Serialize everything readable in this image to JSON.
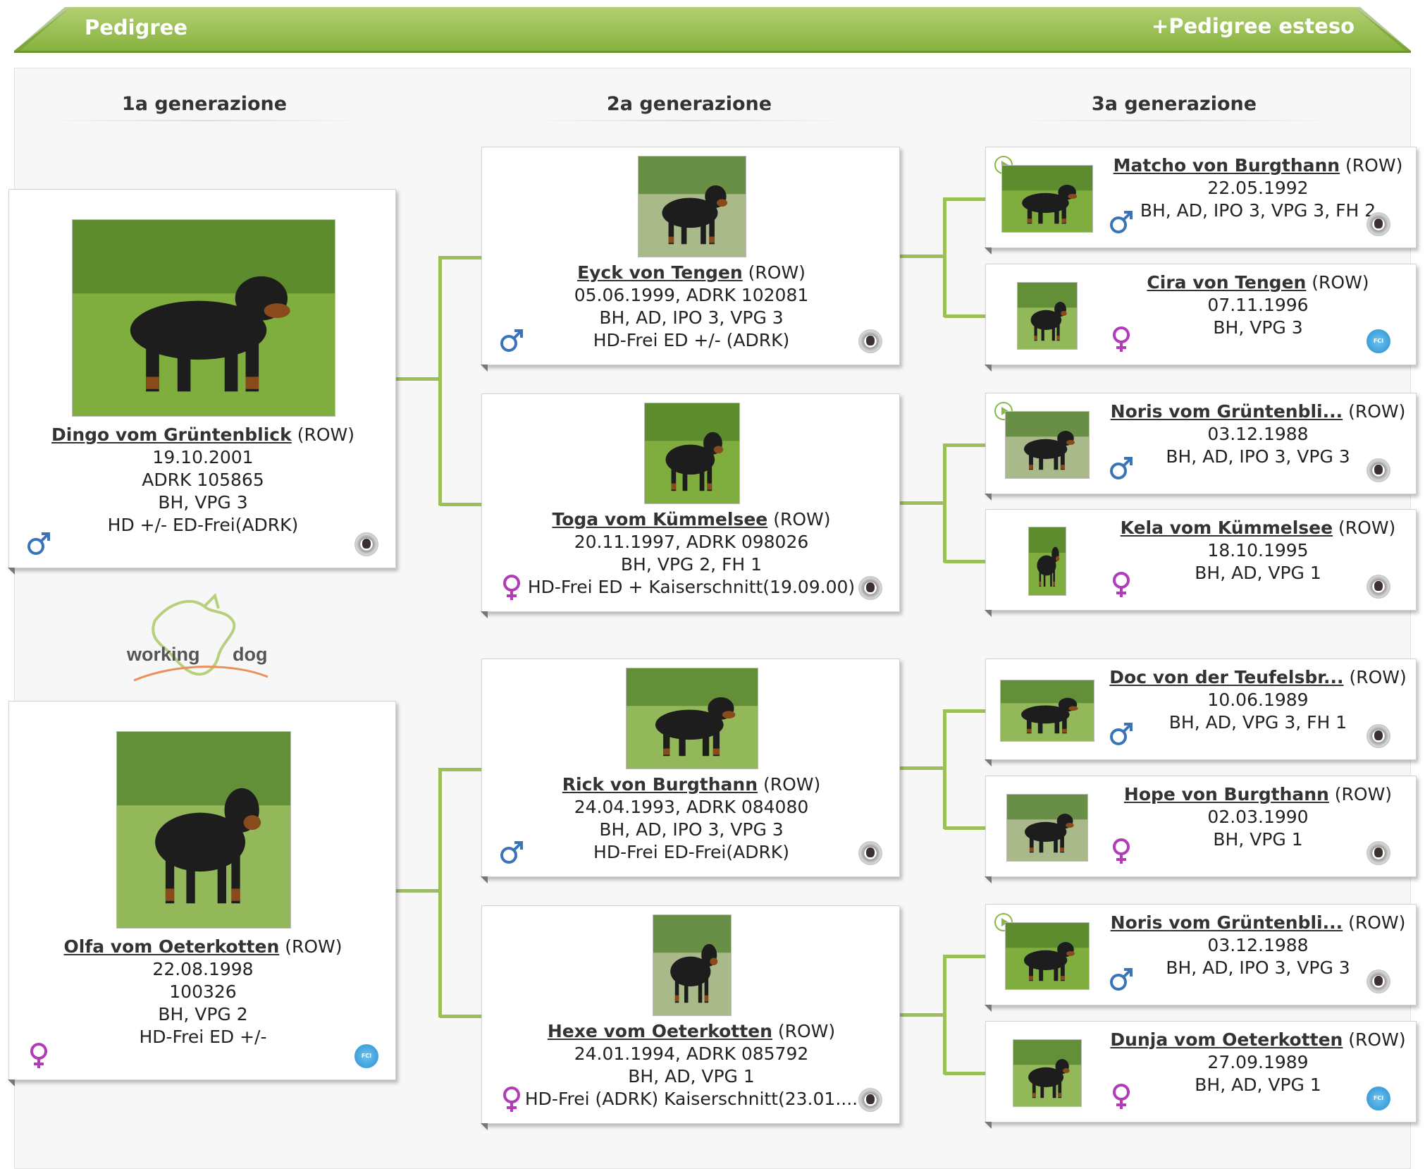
{
  "header": {
    "title": "Pedigree",
    "extended_link": "+Pedigree esteso"
  },
  "generations": [
    "1a generazione",
    "2a generazione",
    "3a generazione"
  ],
  "logo": {
    "text_left": "working",
    "text_right": "dog"
  },
  "colors": {
    "header_green": "#86b23e",
    "connector_green": "#9cc057",
    "male_blue": "#3a74b8",
    "female_purple": "#b23bb7"
  },
  "gen1": [
    {
      "name": "Dingo vom Grüntenblick",
      "suffix": " (ROW)",
      "lines": [
        "19.10.2001",
        "ADRK 105865",
        "BH, VPG 3",
        "HD +/- ED-Frei(ADRK)"
      ],
      "sex": "male",
      "badge": "gray"
    },
    {
      "name": "Olfa vom Oeterkotten",
      "suffix": " (ROW)",
      "lines": [
        "22.08.1998",
        "100326",
        "BH, VPG 2",
        "HD-Frei ED +/-"
      ],
      "sex": "female",
      "badge": "blue"
    }
  ],
  "gen2": [
    {
      "name": "Eyck von Tengen",
      "suffix": " (ROW)",
      "lines": [
        "05.06.1999, ADRK 102081",
        "BH, AD, IPO 3, VPG 3",
        "HD-Frei ED +/- (ADRK)"
      ],
      "sex": "male",
      "badge": "gray"
    },
    {
      "name": "Toga vom Kümmelsee",
      "suffix": " (ROW)",
      "lines": [
        "20.11.1997, ADRK 098026",
        "BH, VPG 2, FH 1",
        "HD-Frei ED + Kaiserschnitt(19.09.00)"
      ],
      "sex": "female",
      "badge": "gray"
    },
    {
      "name": "Rick von Burgthann",
      "suffix": " (ROW)",
      "lines": [
        "24.04.1993, ADRK 084080",
        "BH, AD, IPO 3, VPG 3",
        "HD-Frei ED-Frei(ADRK)"
      ],
      "sex": "male",
      "badge": "gray"
    },
    {
      "name": "Hexe vom Oeterkotten",
      "suffix": " (ROW)",
      "lines": [
        "24.01.1994, ADRK 085792",
        "BH, AD, VPG 1",
        "HD-Frei (ADRK) Kaiserschnitt(23.01...."
      ],
      "sex": "female",
      "badge": "gray"
    }
  ],
  "gen3": [
    {
      "name": "Matcho von Burgthann",
      "suffix": " (ROW)",
      "lines": [
        "22.05.1992",
        "BH, AD, IPO 3, VPG 3, FH 2"
      ],
      "sex": "male",
      "badge": "gray",
      "video": true
    },
    {
      "name": "Cira von Tengen",
      "suffix": " (ROW)",
      "lines": [
        "07.11.1996",
        "BH, VPG 3"
      ],
      "sex": "female",
      "badge": "blue",
      "video": false
    },
    {
      "name": "Noris vom Grüntenbli...",
      "suffix": " (ROW)",
      "lines": [
        "03.12.1988",
        "BH, AD, IPO 3, VPG 3"
      ],
      "sex": "male",
      "badge": "gray",
      "video": true
    },
    {
      "name": "Kela vom Kümmelsee",
      "suffix": " (ROW)",
      "lines": [
        "18.10.1995",
        "BH, AD, VPG 1"
      ],
      "sex": "female",
      "badge": "gray",
      "video": false
    },
    {
      "name": "Doc von der Teufelsbr...",
      "suffix": " (ROW)",
      "lines": [
        "10.06.1989",
        "BH, AD, VPG 3, FH 1"
      ],
      "sex": "male",
      "badge": "gray",
      "video": false
    },
    {
      "name": "Hope von Burgthann",
      "suffix": " (ROW)",
      "lines": [
        "02.03.1990",
        "BH, VPG 1"
      ],
      "sex": "female",
      "badge": "gray",
      "video": false
    },
    {
      "name": "Noris vom Grüntenbli...",
      "suffix": " (ROW)",
      "lines": [
        "03.12.1988",
        "BH, AD, IPO 3, VPG 3"
      ],
      "sex": "male",
      "badge": "gray",
      "video": true
    },
    {
      "name": "Dunja vom Oeterkotten",
      "suffix": " (ROW)",
      "lines": [
        "27.09.1989",
        "BH, AD, VPG 1"
      ],
      "sex": "female",
      "badge": "blue",
      "video": false
    }
  ]
}
